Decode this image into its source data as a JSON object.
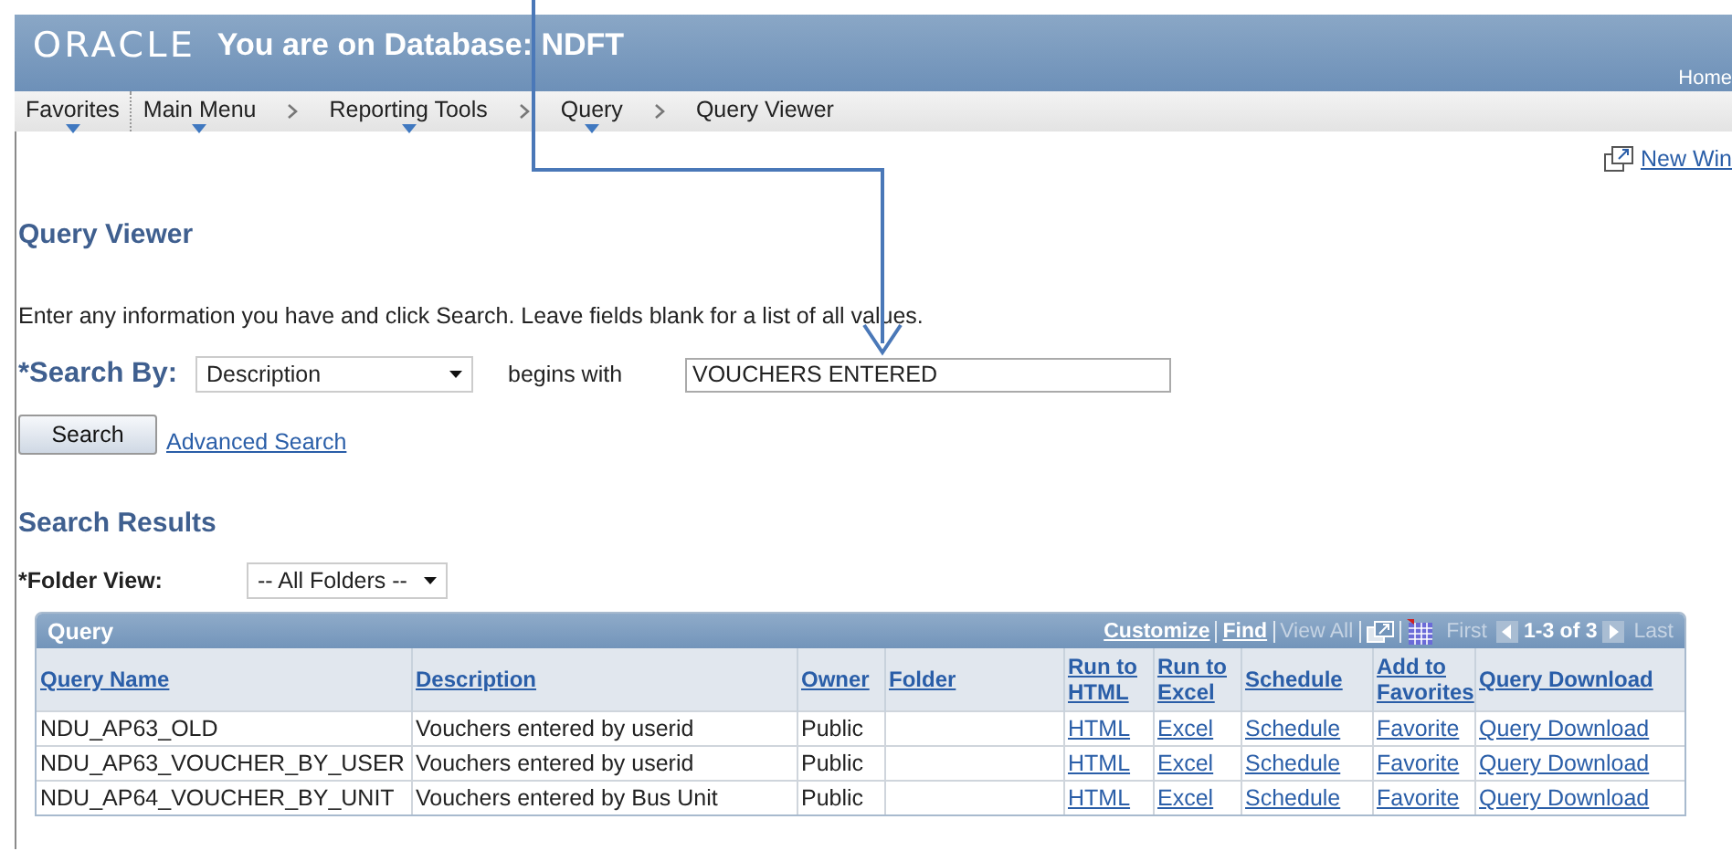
{
  "header": {
    "logo": "ORACLE",
    "title": "You are on Database: NDFT",
    "home_link": "Home"
  },
  "nav": [
    {
      "label": "Favorites",
      "dropdown": true
    },
    {
      "label": "Main Menu",
      "dropdown": true
    },
    {
      "label": "Reporting Tools",
      "dropdown": true
    },
    {
      "label": "Query",
      "dropdown": true
    },
    {
      "label": "Query Viewer",
      "dropdown": false
    }
  ],
  "new_window": "New Win",
  "page_title": "Query Viewer",
  "instructions": "Enter any information you have and click Search. Leave fields blank for a list of all values.",
  "search": {
    "label": "*Search By:",
    "field": "Description",
    "operator": "begins with",
    "value": "VOUCHERS ENTERED",
    "button": "Search",
    "advanced_link": "Advanced Search"
  },
  "results": {
    "title": "Search Results",
    "folder_label": "*Folder View:",
    "folder_value": "-- All Folders --",
    "grid": {
      "title": "Query",
      "toolbar": [
        {
          "label": "Customize",
          "disabled": false
        },
        {
          "label": "Find",
          "disabled": false
        },
        {
          "label": "View All",
          "disabled": true
        }
      ],
      "pager": {
        "first": "First",
        "range": "1-3 of 3",
        "last": "Last"
      },
      "columns": [
        {
          "label": "Query Name",
          "links": false
        },
        {
          "label": "Description",
          "links": false
        },
        {
          "label": "Owner",
          "links": false
        },
        {
          "label": "Folder"
        },
        {
          "label": "Run to HTML",
          "links": true
        },
        {
          "label": "Run to Excel",
          "links": true
        },
        {
          "label": "Schedule",
          "links": true
        },
        {
          "label": "Add to Favorites",
          "links": true
        },
        {
          "label": "Query Download",
          "links": true
        }
      ],
      "rows": [
        {
          "query_name": "NDU_AP63_OLD",
          "description": "Vouchers entered by userid",
          "owner": "Public",
          "run_html": "HTML",
          "run_excel": "Excel",
          "schedule": "Schedule",
          "favorite": "Favorite",
          "download": "Query Download"
        },
        {
          "query_name": "NDU_AP63_VOUCHER_BY_USER",
          "description": "Vouchers entered by userid",
          "owner": "Public",
          "run_html": "HTML",
          "run_excel": "Excel",
          "schedule": "Schedule",
          "favorite": "Favorite",
          "download": "Query Download"
        },
        {
          "query_name": "NDU_AP64_VOUCHER_BY_UNIT",
          "description": "Vouchers entered by Bus Unit",
          "owner": "Public",
          "run_html": "HTML",
          "run_excel": "Excel",
          "schedule": "Schedule",
          "favorite": "Favorite",
          "download": "Query Download"
        }
      ]
    }
  }
}
